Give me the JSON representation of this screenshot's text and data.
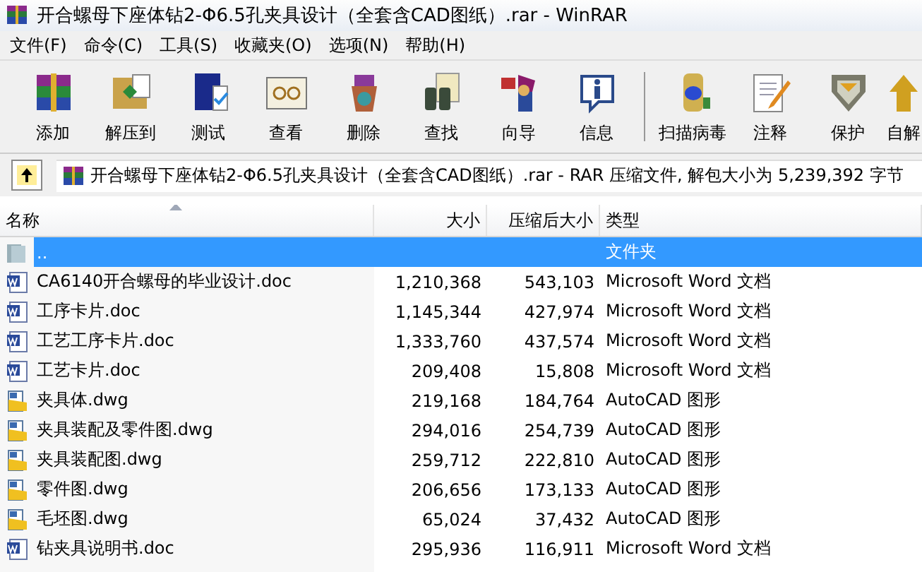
{
  "window": {
    "title": "开合螺母下座体钻2-Φ6.5孔夹具设计（全套含CAD图纸）.rar - WinRAR"
  },
  "menu": [
    "文件(F)",
    "命令(C)",
    "工具(S)",
    "收藏夹(O)",
    "选项(N)",
    "帮助(H)"
  ],
  "toolbar": [
    {
      "label": "添加"
    },
    {
      "label": "解压到"
    },
    {
      "label": "测试"
    },
    {
      "label": "查看"
    },
    {
      "label": "删除"
    },
    {
      "label": "查找"
    },
    {
      "label": "向导"
    },
    {
      "label": "信息"
    },
    {
      "label": "扫描病毒"
    },
    {
      "label": "注释"
    },
    {
      "label": "保护"
    },
    {
      "label": "自解"
    }
  ],
  "address": {
    "text": "开合螺母下座体钻2-Φ6.5孔夹具设计（全套含CAD图纸）.rar - RAR 压缩文件, 解包大小为 5,239,392 字节"
  },
  "table": {
    "columns": [
      "名称",
      "大小",
      "压缩后大小",
      "类型"
    ],
    "rows": [
      {
        "kind": "folder",
        "name": "..",
        "size": "",
        "packed": "",
        "type": "文件夹",
        "selected": true
      },
      {
        "kind": "word",
        "name": "CA6140开合螺母的毕业设计.doc",
        "size": "1,210,368",
        "packed": "543,103",
        "type": "Microsoft Word 文档",
        "selected": false
      },
      {
        "kind": "word",
        "name": "工序卡片.doc",
        "size": "1,145,344",
        "packed": "427,974",
        "type": "Microsoft Word 文档",
        "selected": false
      },
      {
        "kind": "word",
        "name": "工艺工序卡片.doc",
        "size": "1,333,760",
        "packed": "437,574",
        "type": "Microsoft Word 文档",
        "selected": false
      },
      {
        "kind": "word",
        "name": "工艺卡片.doc",
        "size": "209,408",
        "packed": "15,808",
        "type": "Microsoft Word 文档",
        "selected": false
      },
      {
        "kind": "dwg",
        "name": "夹具体.dwg",
        "size": "219,168",
        "packed": "184,764",
        "type": "AutoCAD 图形",
        "selected": false
      },
      {
        "kind": "dwg",
        "name": "夹具装配及零件图.dwg",
        "size": "294,016",
        "packed": "254,739",
        "type": "AutoCAD 图形",
        "selected": false
      },
      {
        "kind": "dwg",
        "name": "夹具装配图.dwg",
        "size": "259,712",
        "packed": "222,810",
        "type": "AutoCAD 图形",
        "selected": false
      },
      {
        "kind": "dwg",
        "name": "零件图.dwg",
        "size": "206,656",
        "packed": "173,133",
        "type": "AutoCAD 图形",
        "selected": false
      },
      {
        "kind": "dwg",
        "name": "毛坯图.dwg",
        "size": "65,024",
        "packed": "37,432",
        "type": "AutoCAD 图形",
        "selected": false
      },
      {
        "kind": "word",
        "name": "钻夹具说明书.doc",
        "size": "295,936",
        "packed": "116,911",
        "type": "Microsoft Word 文档",
        "selected": false
      }
    ]
  }
}
